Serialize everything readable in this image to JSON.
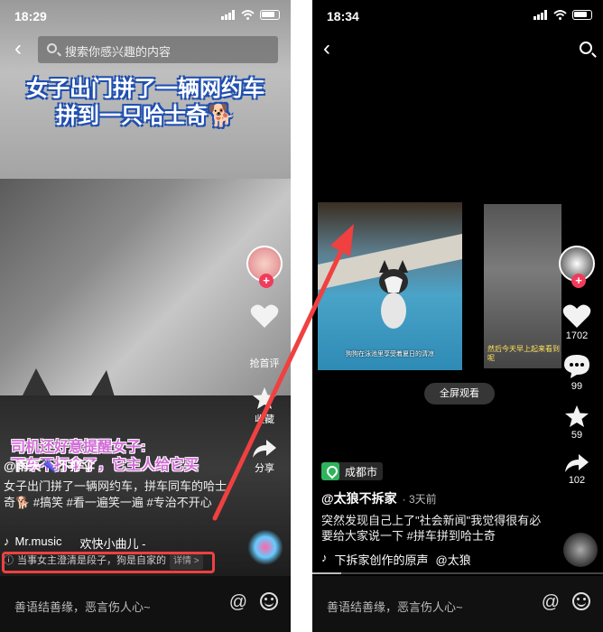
{
  "left": {
    "status": {
      "time": "18:29"
    },
    "search": {
      "placeholder": "搜索你感兴趣的内容"
    },
    "headline": {
      "line1": "女子出门拼了一辆网约车",
      "line2": "拼到一只哈士奇🐕"
    },
    "rail": {
      "plus": "+",
      "share_label": "抢首评",
      "favorite_label": "收藏",
      "forward_label": "分享"
    },
    "overlay_caption": {
      "line1": "司机还好意提醒女子:",
      "line2": "下车不打伞了，它主人给它买"
    },
    "author": "@雨天🌂不打伞",
    "description": "女子出门拼了一辆网约车，拼车同车的哈士奇🐕 #搞笑 #看一遍笑一遍 #专治不开心",
    "music": {
      "note": "♪",
      "artist": "Mr.music",
      "song": "欢快小曲儿 -"
    },
    "notice": {
      "icon": "ⓘ",
      "text": "当事女主澄清是段子，狗是自家的",
      "tag": "详情 >"
    },
    "bottom": {
      "comment": "善语结善缘，恶言伤人心~",
      "at": "@"
    }
  },
  "right": {
    "status": {
      "time": "18:34"
    },
    "thumbs": {
      "pool_caption": "狗狗在泳池里享受着夏日的清凉",
      "car_caption": "然后今天早上起来看到呢"
    },
    "fullscreen": "全屏观看",
    "rail": {
      "likes": "1702",
      "comments": "99",
      "favorites": "59",
      "shares": "102",
      "plus": "+"
    },
    "location": "成都市",
    "author": "@太狼不拆家",
    "timestamp": "· 3天前",
    "description": "突然发现自己上了\"社会新闻\"我觉得很有必要给大家说一下 #拼车拼到哈士奇",
    "music": {
      "note": "♪",
      "text": "下拆家创作的原声",
      "artist": "@太狼"
    },
    "bottom": {
      "comment": "善语结善缘，恶言伤人心~",
      "at": "@"
    }
  },
  "colors": {
    "annotation": "#f04040",
    "plus": "#f03c5a",
    "location": "#2fb35c"
  }
}
